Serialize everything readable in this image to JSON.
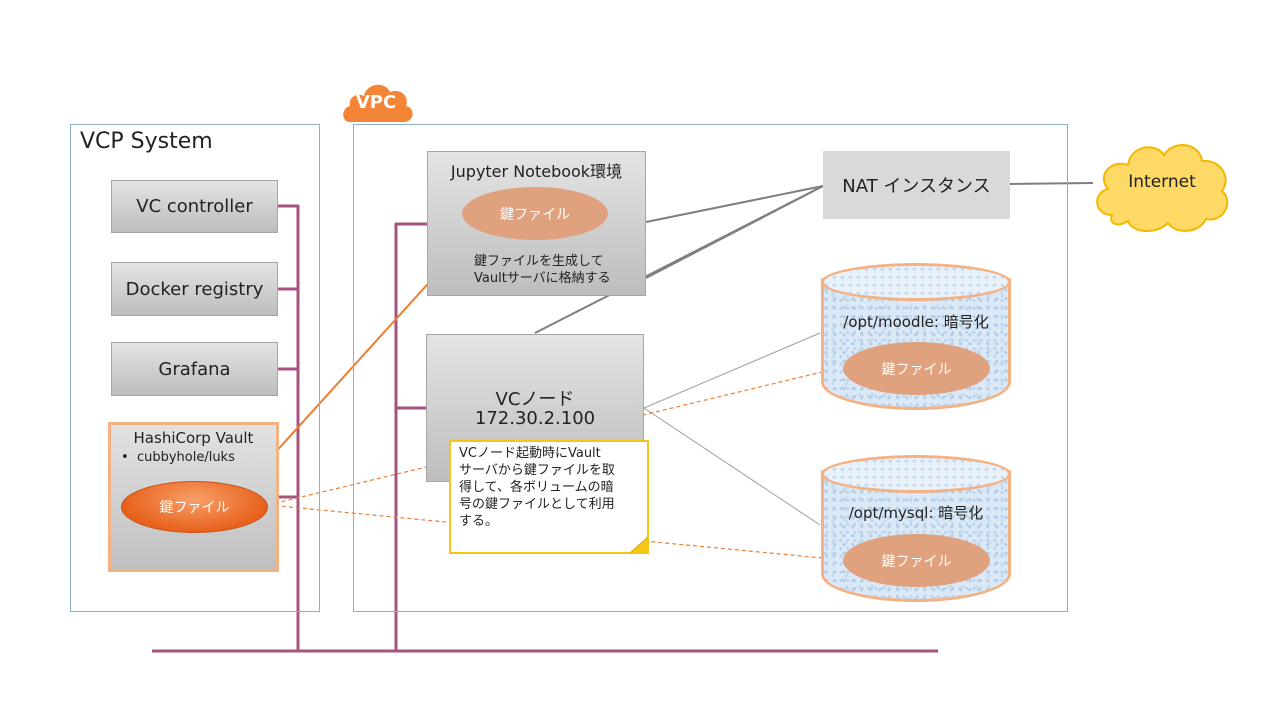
{
  "vcp_system": {
    "title": "VCP System",
    "components": [
      "VC controller",
      "Docker registry",
      "Grafana"
    ],
    "vault": {
      "title": "HashiCorp Vault",
      "bullet": "cubbyhole/luks",
      "key_label": "鍵ファイル"
    }
  },
  "vpc": {
    "badge": "VPC",
    "jupyter": {
      "title": "Jupyter Notebook環境",
      "key_label": "鍵ファイル",
      "note_line1": "鍵ファイルを生成して",
      "note_line2": "Vaultサーバに格納する"
    },
    "nat": "NAT インスタンス",
    "internet": "Internet",
    "vc_node": {
      "name": "VCノード",
      "ip": "172.30.2.100"
    },
    "volumes": [
      {
        "title": "/opt/moodle: 暗号化",
        "key_label": "鍵ファイル"
      },
      {
        "title": "/opt/mysql: 暗号化",
        "key_label": "鍵ファイル"
      }
    ],
    "callout": {
      "lines": [
        "VCノード起動時にVault",
        "サーバから鍵ファイルを取",
        "得して、各ボリュームの暗",
        "号の鍵ファイルとして利用",
        "する。"
      ]
    }
  },
  "colors": {
    "network_line": "#a5547e",
    "vault_border": "#f4b183",
    "vpc_orange": "#f58536",
    "key_orange": "#ed7d31",
    "callout_border": "#f5c518",
    "frame_border": "#8fb0c8"
  }
}
